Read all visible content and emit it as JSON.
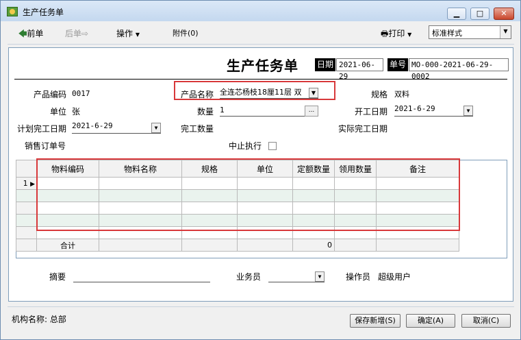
{
  "window": {
    "title": "生产任务单"
  },
  "toolbar": {
    "prev": "前单",
    "next": "后单",
    "ops": "操作",
    "attach": "附件(0)",
    "print": "打印",
    "style_value": "标准样式"
  },
  "form": {
    "title": "生产任务单",
    "date_label": "日期",
    "date_value": "2021-06-29",
    "no_label": "单号",
    "no_value": "MO-000-2021-06-29-0002",
    "product_code_label": "产品编码",
    "product_code": "0017",
    "product_name_label": "产品名称",
    "product_name": "全连芯杨枝18厘11层 双",
    "spec_label": "规格",
    "spec": "双料",
    "unit_label": "单位",
    "unit": "张",
    "qty_label": "数量",
    "qty": "1",
    "start_label": "开工日期",
    "start": "2021-6-29",
    "plan_end_label": "计划完工日期",
    "plan_end": "2021-6-29",
    "done_qty_label": "完工数量",
    "actual_end_label": "实际完工日期",
    "so_label": "销售订单号",
    "stop_label": "中止执行"
  },
  "grid": {
    "headers": [
      "物料编码",
      "物料名称",
      "规格",
      "单位",
      "定额数量",
      "领用数量",
      "备注"
    ],
    "row_number": "1",
    "total_label": "合计",
    "total_qty": "0"
  },
  "footer": {
    "summary_label": "摘要",
    "salesman_label": "业务员",
    "operator_label": "操作员",
    "operator": "超级用户"
  },
  "status": {
    "org": "机构名称: 总部",
    "save_new": "保存新增(S)",
    "ok": "确定(A)",
    "cancel": "取消(C)"
  }
}
